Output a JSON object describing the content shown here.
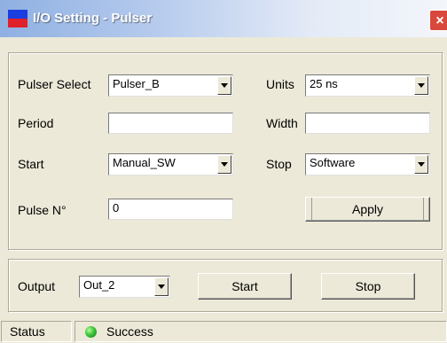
{
  "window": {
    "title": "I/O Setting - Pulser",
    "close_glyph": "×"
  },
  "pulser_select": {
    "label": "Pulser Select",
    "value": "Pulser_B"
  },
  "units": {
    "label": "Units",
    "value": "25 ns"
  },
  "period": {
    "label": "Period",
    "value": ""
  },
  "width": {
    "label": "Width",
    "value": ""
  },
  "start_mode": {
    "label": "Start",
    "value": "Manual_SW"
  },
  "stop_mode": {
    "label": "Stop",
    "value": "Software"
  },
  "pulse_n": {
    "label": "Pulse N°",
    "value": "0"
  },
  "apply_label": "Apply",
  "output": {
    "label": "Output",
    "value": "Out_2"
  },
  "start_button": "Start",
  "stop_button": "Stop",
  "status": {
    "label": "Status",
    "text": "Success",
    "led_color": "#3ec43a"
  }
}
